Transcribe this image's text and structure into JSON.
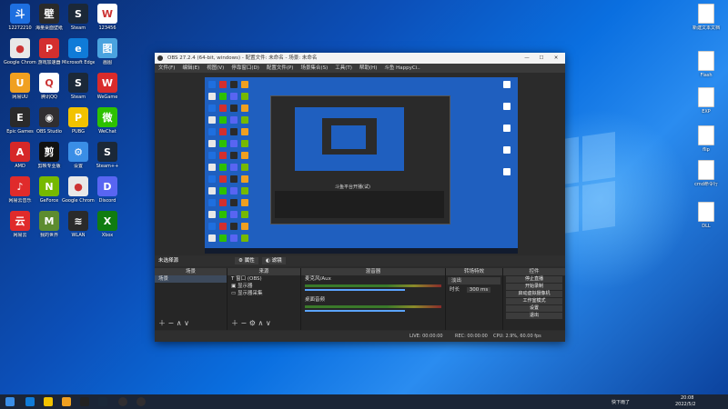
{
  "desktop_left_icons": [
    {
      "label": "12272210",
      "color": "#1e6fe0",
      "glyph": "斗"
    },
    {
      "label": "海量桌面壁纸",
      "color": "#2a2a2a",
      "glyph": "壁"
    },
    {
      "label": "Steam",
      "color": "#1b2838",
      "glyph": "S"
    },
    {
      "label": "123456",
      "color": "#ffffff",
      "glyph": "W"
    },
    {
      "label": "Google Chrome",
      "color": "#e8e8e8",
      "glyph": "●"
    },
    {
      "label": "游戏加速器",
      "color": "#d32f2f",
      "glyph": "P"
    },
    {
      "label": "Microsoft Edge",
      "color": "#0f7bd8",
      "glyph": "e"
    },
    {
      "label": "画图",
      "color": "#4aa3df",
      "glyph": "图"
    },
    {
      "label": "网易UU",
      "color": "#f0a020",
      "glyph": "U"
    },
    {
      "label": "腾讯QQ",
      "color": "#ffffff",
      "glyph": "Q"
    },
    {
      "label": "Steam",
      "color": "#1b2838",
      "glyph": "S"
    },
    {
      "label": "WeGame",
      "color": "#d92b2b",
      "glyph": "W"
    },
    {
      "label": "Epic Games",
      "color": "#2a2a2a",
      "glyph": "E"
    },
    {
      "label": "OBS Studio",
      "color": "#302e31",
      "glyph": "◉"
    },
    {
      "label": "PUBG",
      "color": "#f2c200",
      "glyph": "P"
    },
    {
      "label": "WeChat",
      "color": "#2dc100",
      "glyph": "微"
    },
    {
      "label": "AMD",
      "color": "#d62828",
      "glyph": "A"
    },
    {
      "label": "剪映专业版",
      "color": "#111111",
      "glyph": "剪"
    },
    {
      "label": "设置",
      "color": "#3a8ee6",
      "glyph": "⚙"
    },
    {
      "label": "Steam++",
      "color": "#1b2838",
      "glyph": "S"
    },
    {
      "label": "网易云音乐",
      "color": "#e02b2b",
      "glyph": "♪"
    },
    {
      "label": "GeForce",
      "color": "#76b900",
      "glyph": "N"
    },
    {
      "label": "Google Chrome",
      "color": "#e8e8e8",
      "glyph": "●"
    },
    {
      "label": "Discord",
      "color": "#5865f2",
      "glyph": "D"
    },
    {
      "label": "网易云",
      "color": "#e02b2b",
      "glyph": "云"
    },
    {
      "label": "我的世界",
      "color": "#5d8c2f",
      "glyph": "M"
    },
    {
      "label": "WLAN",
      "color": "#2a2a2a",
      "glyph": "≋"
    },
    {
      "label": "Xbox",
      "color": "#107c10",
      "glyph": "X"
    }
  ],
  "desktop_right_icons": [
    {
      "label": "新建文本文档"
    },
    {
      "label": "Flash"
    },
    {
      "label": "EXP"
    },
    {
      "label": "flip"
    },
    {
      "label": "cmd命令行"
    },
    {
      "label": "DLL"
    }
  ],
  "obs": {
    "title": "OBS 27.2.4 (64-bit, windows) - 配置文件: 未命名 - 场景: 未命名",
    "menu": [
      "文件(F)",
      "编辑(E)",
      "视图(V)",
      "停靠窗口(D)",
      "配置文件(P)",
      "场景集合(S)",
      "工具(T)",
      "帮助(H)",
      "斗鱼 HappyCi.."
    ],
    "preview_caption": "斗鱼平台开播(试)",
    "scene_bar_label": "未选择源",
    "scene_bar_btn1": "属性",
    "scene_bar_btn2": "滤镜",
    "docks": {
      "scenes": {
        "title": "场景",
        "items": [
          "场景"
        ]
      },
      "sources": {
        "title": "来源",
        "items": [
          "窗口 (OBS)",
          "显示器",
          "显示器采集"
        ]
      },
      "mixer": {
        "title": "混音器",
        "tracks": [
          "桌面音频",
          "麦克风/Aux",
          "麦克风"
        ]
      },
      "transitions": {
        "title": "转场特效",
        "type": "淡出",
        "duration_label": "时长",
        "duration": "300 ms"
      },
      "controls": {
        "title": "控件",
        "buttons": [
          "停止直播",
          "开始录制",
          "启动虚拟摄像机",
          "工作室模式",
          "设置",
          "退出"
        ]
      }
    },
    "status": {
      "live": "LIVE: 00:00:00",
      "rec": "REC: 00:00:00",
      "cpu": "CPU: 2.9%, 60.00 fps"
    }
  },
  "taskbar": {
    "weather": "快下雨了",
    "time": "20:08",
    "date": "2022/5/2"
  }
}
